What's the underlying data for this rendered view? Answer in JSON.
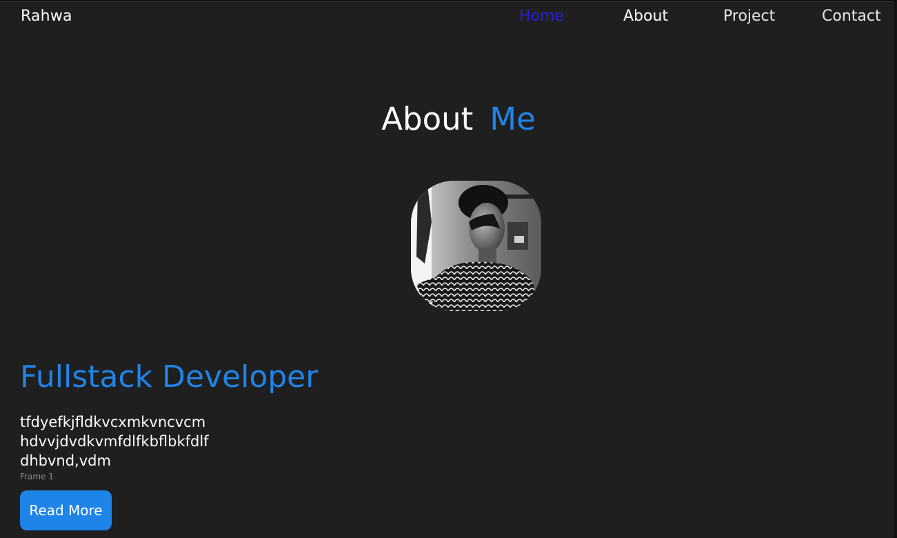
{
  "nav": {
    "brand": "Rahwa",
    "links": [
      {
        "label": "Home",
        "active": true
      },
      {
        "label": "About",
        "active": false
      },
      {
        "label": "Project",
        "active": false
      },
      {
        "label": "Contact",
        "active": false
      }
    ]
  },
  "about": {
    "title_part1": "About",
    "title_part2": "Me"
  },
  "avatar_icon": "profile-photo",
  "profile": {
    "role": "Fullstack Developer",
    "bio_lines": [
      "tfdyefkjfldkvcxmkvncvcm",
      "hdvvjdvdkvmfdlfkbflbkfdlf",
      "dhbvnd,vdm"
    ],
    "frame_label": "Frame 1",
    "button_label": "Read More"
  },
  "colors": {
    "background": "#1f1f1f",
    "accent": "#1f84e8",
    "active_nav": "#2a1ed6",
    "text": "#ffffff",
    "muted": "#8a8a8a"
  }
}
